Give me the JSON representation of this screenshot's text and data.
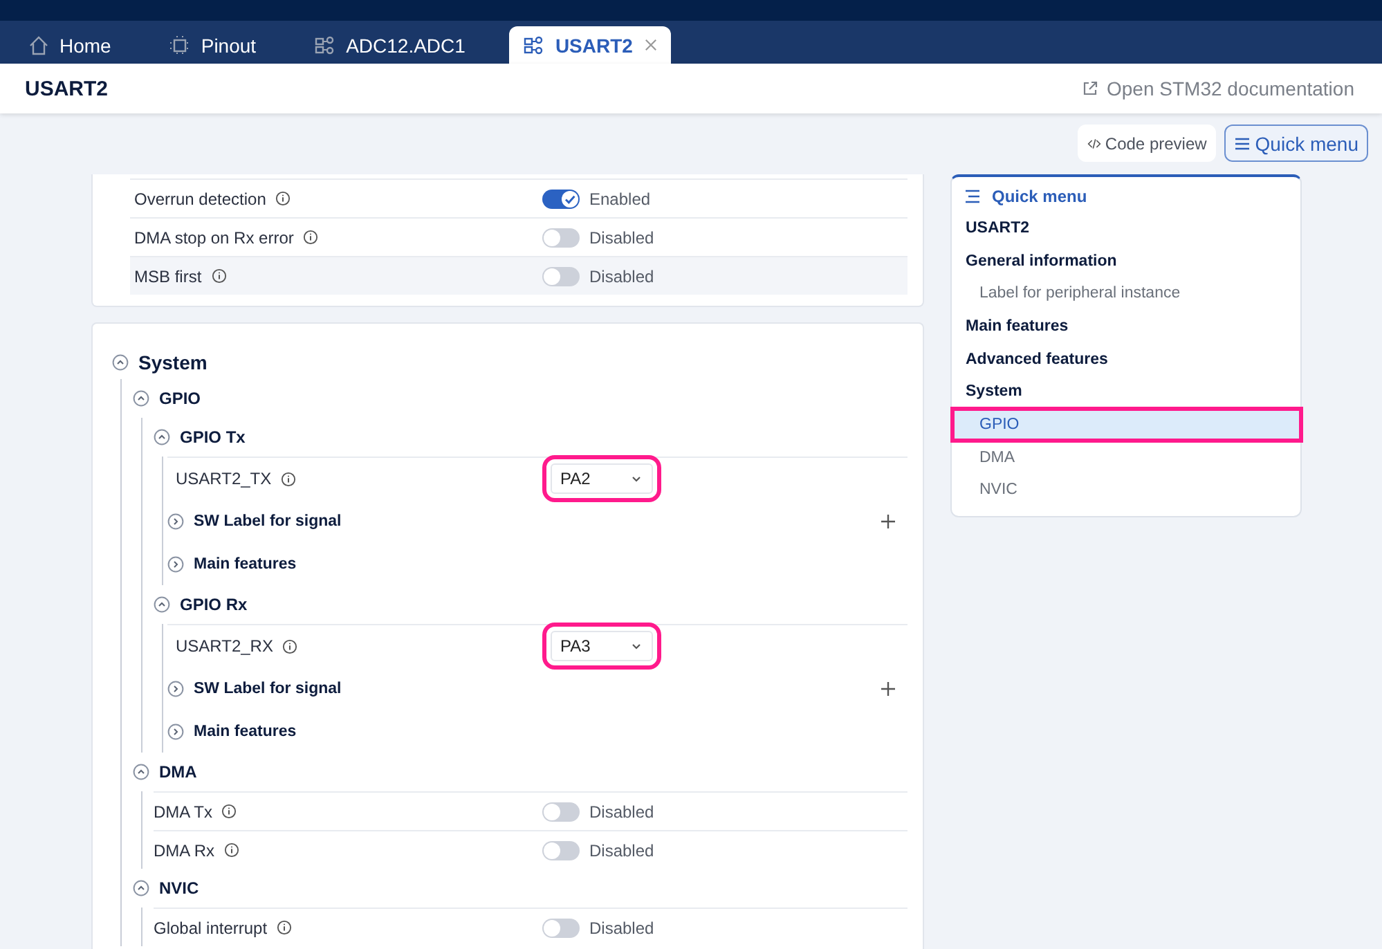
{
  "tabs": [
    {
      "kind": "home",
      "label": "Home",
      "selected": false,
      "closable": false
    },
    {
      "kind": "pinout",
      "label": "Pinout",
      "selected": false,
      "closable": false
    },
    {
      "kind": "peripheral",
      "label": "ADC12.ADC1",
      "selected": false,
      "closable": false
    },
    {
      "kind": "peripheral",
      "label": "USART2",
      "selected": true,
      "closable": true
    }
  ],
  "header": {
    "title": "USART2",
    "doc_link": "Open STM32 documentation"
  },
  "toolbar": {
    "code_preview": "Code preview",
    "quick_menu": "Quick menu"
  },
  "advanced_rows": [
    {
      "label": "Overrun detection",
      "on": true,
      "state": "Enabled",
      "shaded": false
    },
    {
      "label": "DMA stop on Rx error",
      "on": false,
      "state": "Disabled",
      "shaded": false
    },
    {
      "label": "MSB first",
      "on": false,
      "state": "Disabled",
      "shaded": true
    }
  ],
  "system": {
    "title": "System",
    "expanded": true,
    "children": [
      {
        "kind": "group",
        "title": "GPIO",
        "expanded": true,
        "children": [
          {
            "kind": "group",
            "title": "GPIO Tx",
            "expanded": true,
            "children": [
              {
                "kind": "select",
                "label": "USART2_TX",
                "value": "PA2",
                "highlighted": true
              },
              {
                "kind": "collapsed",
                "title": "SW Label for signal",
                "addable": true
              },
              {
                "kind": "collapsed",
                "title": "Main features",
                "addable": false
              }
            ]
          },
          {
            "kind": "group",
            "title": "GPIO Rx",
            "expanded": true,
            "children": [
              {
                "kind": "select",
                "label": "USART2_RX",
                "value": "PA3",
                "highlighted": true
              },
              {
                "kind": "collapsed",
                "title": "SW Label for signal",
                "addable": true
              },
              {
                "kind": "collapsed",
                "title": "Main features",
                "addable": false
              }
            ]
          }
        ]
      },
      {
        "kind": "group",
        "title": "DMA",
        "expanded": true,
        "children": [
          {
            "kind": "toggle",
            "label": "DMA Tx",
            "on": false,
            "state": "Disabled"
          },
          {
            "kind": "toggle",
            "label": "DMA Rx",
            "on": false,
            "state": "Disabled"
          }
        ]
      },
      {
        "kind": "group",
        "title": "NVIC",
        "expanded": true,
        "children": [
          {
            "kind": "toggle",
            "label": "Global interrupt",
            "on": false,
            "state": "Disabled"
          }
        ]
      }
    ]
  },
  "quick_menu": {
    "title": "Quick menu",
    "items": [
      {
        "kind": "section",
        "label": "USART2",
        "selected": false,
        "highlighted": false
      },
      {
        "kind": "section",
        "label": "General information",
        "selected": false,
        "highlighted": false
      },
      {
        "kind": "entry",
        "label": "Label for peripheral instance",
        "selected": false,
        "highlighted": false
      },
      {
        "kind": "section",
        "label": "Main features",
        "selected": false,
        "highlighted": false
      },
      {
        "kind": "section",
        "label": "Advanced features",
        "selected": false,
        "highlighted": false
      },
      {
        "kind": "section",
        "label": "System",
        "selected": false,
        "highlighted": false
      },
      {
        "kind": "entry",
        "label": "GPIO",
        "selected": true,
        "highlighted": true
      },
      {
        "kind": "entry",
        "label": "DMA",
        "selected": false,
        "highlighted": false
      },
      {
        "kind": "entry",
        "label": "NVIC",
        "selected": false,
        "highlighted": false
      }
    ]
  }
}
